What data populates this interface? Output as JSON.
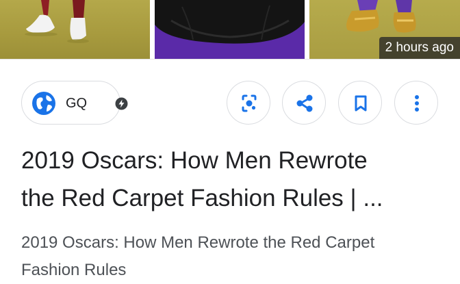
{
  "images": [
    {
      "name": "red-carpet-photo-1"
    },
    {
      "name": "red-carpet-photo-2"
    },
    {
      "name": "red-carpet-photo-3"
    }
  ],
  "time_badge": "2 hours ago",
  "source": {
    "name": "GQ",
    "icon": "globe-icon",
    "badge_icon": "verified-icon"
  },
  "actions": [
    {
      "icon": "lens-icon"
    },
    {
      "icon": "share-icon"
    },
    {
      "icon": "bookmark-icon"
    },
    {
      "icon": "more-vert-icon"
    }
  ],
  "headline_line1": "2019 Oscars: How Men Rewrote",
  "headline_line2": "the Red Carpet Fashion Rules | ...",
  "snippet_line1": "2019 Oscars: How Men Rewrote the Red Carpet",
  "snippet_line2": "Fashion Rules",
  "colors": {
    "accent": "#1a73e8",
    "border": "#dadce0",
    "text": "#202124",
    "muted": "#4d5156"
  }
}
